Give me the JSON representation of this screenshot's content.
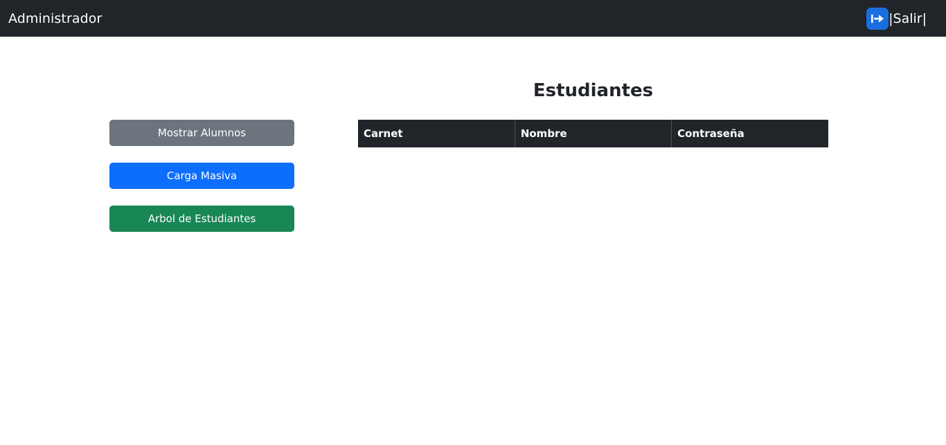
{
  "navbar": {
    "brand": "Administrador",
    "logout_label": "|Salir|",
    "logout_icon": "logout-arrow-icon",
    "logout_icon_color": "#1a6fe0"
  },
  "sidebar": {
    "buttons": [
      {
        "label": "Mostrar Alumnos",
        "color": "#6c757d"
      },
      {
        "label": "Carga Masiva",
        "color": "#0d6efd"
      },
      {
        "label": "Arbol de Estudiantes",
        "color": "#198754"
      }
    ]
  },
  "main": {
    "title": "Estudiantes",
    "table": {
      "columns": [
        "Carnet",
        "Nombre",
        "Contraseña"
      ],
      "rows": []
    }
  },
  "colors": {
    "navbar_bg": "#212529",
    "table_header_bg": "#212529"
  }
}
